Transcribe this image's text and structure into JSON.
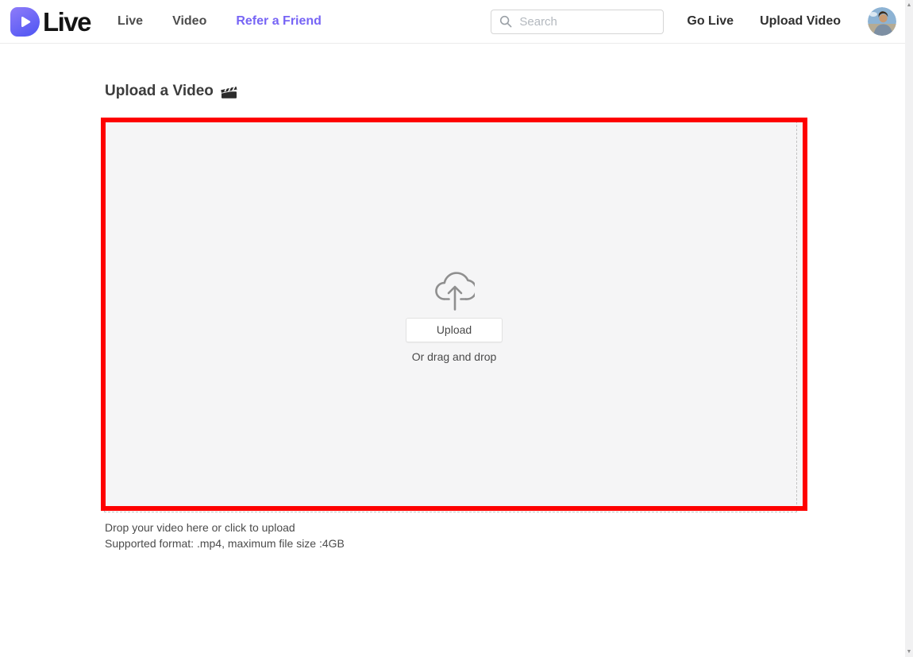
{
  "header": {
    "brand": "Live",
    "nav": [
      {
        "label": "Live"
      },
      {
        "label": "Video"
      },
      {
        "label": "Refer a Friend",
        "active": true
      }
    ],
    "search": {
      "placeholder": "Search"
    },
    "go_live_label": "Go Live",
    "upload_video_label": "Upload Video"
  },
  "main": {
    "title": "Upload a Video",
    "dropzone": {
      "upload_button_label": "Upload",
      "drag_hint": "Or drag and drop"
    },
    "instructions": [
      "Drop your video here or click to upload",
      "Supported format: .mp4, maximum file size :4GB"
    ]
  },
  "icons": {
    "logo_play": "play-triangle",
    "title_clapper": "🎬",
    "search": "magnifier",
    "upload_cloud": "cloud-with-up-arrow",
    "scroll_up": "▲",
    "scroll_down": "▼"
  },
  "colors": {
    "accent_purple": "#7765f5",
    "highlight_red": "#fe0100",
    "dropzone_bg": "#f5f5f6",
    "logo_gradient_start": "#8b7af9",
    "logo_gradient_end": "#5056f3"
  }
}
